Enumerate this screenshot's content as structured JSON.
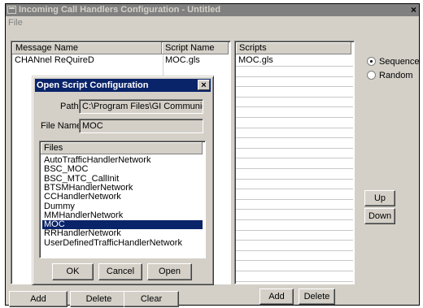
{
  "window": {
    "title": "Incoming Call Handlers Configuration - Untitled",
    "close": "×",
    "menu": [
      "File"
    ]
  },
  "handlers": {
    "columns": [
      "Message Name",
      "Script Name"
    ],
    "rows": [
      {
        "message": "CHANnel ReQuireD",
        "script": "MOC.gls"
      }
    ],
    "buttons": {
      "add": "Add",
      "delete": "Delete",
      "clear": "Clear"
    }
  },
  "scripts": {
    "header": "Scripts",
    "items": [
      "MOC.gls"
    ],
    "buttons": {
      "add": "Add",
      "delete": "Delete"
    }
  },
  "mode": {
    "options": [
      "Sequence",
      "Random"
    ],
    "selected": "Sequence"
  },
  "order_buttons": {
    "up": "Up",
    "down": "Down"
  },
  "dialog": {
    "title": "Open Script Configuration",
    "close": "×",
    "path_label": "Path",
    "path_value": "C:\\Program Files\\GI Communicatio",
    "filename_label": "File Name",
    "filename_value": "MOC",
    "files_header": "Files",
    "files": [
      "AutoTrafficHandlerNetwork",
      "BSC_MOC",
      "BSC_MTC_CallInit",
      "BTSMHandlerNetwork",
      "CCHandlerNetwork",
      "Dummy",
      "MMHandlerNetwork",
      "MOC",
      "RRHandlerNetwork",
      "UserDefinedTrafficHandlerNetwork"
    ],
    "selected_file": "MOC",
    "buttons": {
      "ok": "OK",
      "cancel": "Cancel",
      "open": "Open"
    }
  }
}
